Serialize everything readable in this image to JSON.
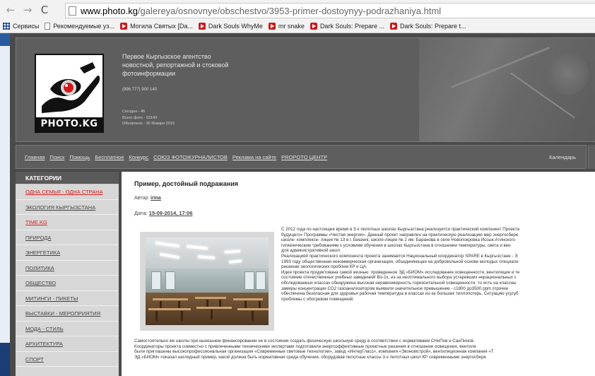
{
  "browser": {
    "url_host": "www.photo.kg",
    "url_path": "/galereya/osnovnye/obschestvo/3953-primer-dostoynyy-podrazhaniya.html",
    "bookmarks": [
      {
        "label": "Сервисы",
        "icon": "apps-icon"
      },
      {
        "label": "Рекомендуемые уз...",
        "icon": "page-icon"
      },
      {
        "label": "Могила Святых [Da...",
        "icon": "youtube-icon"
      },
      {
        "label": "Dark Souls WhyMe",
        "icon": "youtube-icon"
      },
      {
        "label": "mr snake",
        "icon": "youtube-icon"
      },
      {
        "label": "Dark Souls: Prepare ...",
        "icon": "youtube-icon"
      },
      {
        "label": "Dark Souls: Prepare t...",
        "icon": "youtube-icon"
      }
    ]
  },
  "site": {
    "logo_text": "PHOTO.KG",
    "agency": "Первое Кыргызское агентство новостной, репортажной и стоковой фотоинформации",
    "phone": "(996 777) 900 140",
    "stats": [
      "Сегодня - 46",
      "Всего фото - 53149",
      "Обновлено - 30 Января 2015"
    ],
    "menu": [
      "Главная",
      "Поиск",
      "Помощь",
      "Бесплатное",
      "Конкурс",
      "СОЮЗ ФОТОЖУРНАЛИСТОВ",
      "Реклама на сайте",
      "PROPOTO ЦЕНТР"
    ],
    "calendar": "Календарь"
  },
  "sidebar": {
    "heading": "КАТЕГОРИИ",
    "categories": [
      {
        "label": "ОДНА СЕМЬЯ - ОДНА СТРАНА",
        "red": true
      },
      {
        "label": "ЭКОЛОГИЯ КЫРГЫЗСТАНА",
        "red": false
      },
      {
        "label": "TIME.KG",
        "red": true
      },
      {
        "label": "ПРИРОДА",
        "red": false
      },
      {
        "label": "ЭНЕРГЕТИКА",
        "red": false
      },
      {
        "label": "ПОЛИТИКА",
        "red": false
      },
      {
        "label": "ОБЩЕСТВО",
        "red": false
      },
      {
        "label": "МИТИНГИ - ПИКЕТЫ",
        "red": false
      },
      {
        "label": "ВЫСТАВКИ - МЕРОПРИЯТИЯ",
        "red": false
      },
      {
        "label": "МОДА - СТИЛЬ",
        "red": false
      },
      {
        "label": "АРХИТЕКТУРА",
        "red": false
      },
      {
        "label": "СПОРТ",
        "red": false
      }
    ]
  },
  "article": {
    "title": "Пример, достойный подражания",
    "author_label": "Автор:",
    "author": "irina",
    "date_label": "Дата:",
    "date": "15-09-2014, 17:06",
    "side_lines": [
      "С 2012 года по настоящее время в 3-х пилотных школах Кыргызстана реализуется практический компонент Проекта",
      "будущего» Программы «Чистая энергия». Данный проект направлен на практическую реализацию мер энергосбере",
      "школе- комплексе- лицее № 13 в г. Бишкек; школе-лицее № 2 им. Баранова в селе Новопокровка Иссык-Атинского",
      "гигиеническим требованиям к условиям обучения в школах Кыргызстана в отношении температуры, света и вен",
      "для административной школ.",
      "Реализацией практического компонента проекта занимается Национальный координатор SPARE в Кыргызстане - Э",
      "1993 году общественная некоммерческая организация, объединяющая на добровольной основе молодых специали",
      "решении экологических проблем КР и ЦА.",
      "Идея проекта продиктована самой жизнью: проведенное ЭД «БИОМ» исследование освещенности, вентиляции и те",
      "состояние отечественных учебных заведений! Во-1х, из-за неоптимального выбора устаревших нерациональных с",
      "обследованных классах обнаружена высокая неравномерность горизонтальной освещенности, то есть на классны",
      "замеры концентрации CO2 газоанализатором выявили значительное превышение - с1800 до3500 ppm (прочие",
      "обеспечена безопасная для здоровья рабочая температура в классах из-за больших теплопотерь. Ситуацию усугуб",
      "проблемы с обогревом помещений."
    ],
    "full_lines": [
      "Самостоятельно же школы при нынешнем финансировании не в состоянии создать физическую школьную среду в соответствии с нормативами СНиПов и СанПинов.",
      "Координаторы проекта совместно с привлеченными техническими экспертами подготовили энергоэффективные проектные решения в отношении освещения, вентиля",
      "были приглашены высокопрофессиональная организация «Современные световые технологии», завод «ИнтерГласс», компания «Экономстрой», вентиляционная компания «Т",
      "ЭД «БИОМ» показал наглядный пример, какой должна быть нормативная среда обучения, оборудовав пилотные классы 3-х пилотных школ КР современными энергосбере"
    ]
  },
  "colors": {
    "site_bg": "#4a4a4a",
    "header_bg": "#5e5e5e",
    "sidebar_bg": "#d7d7d7",
    "accent_red": "#d62020"
  }
}
